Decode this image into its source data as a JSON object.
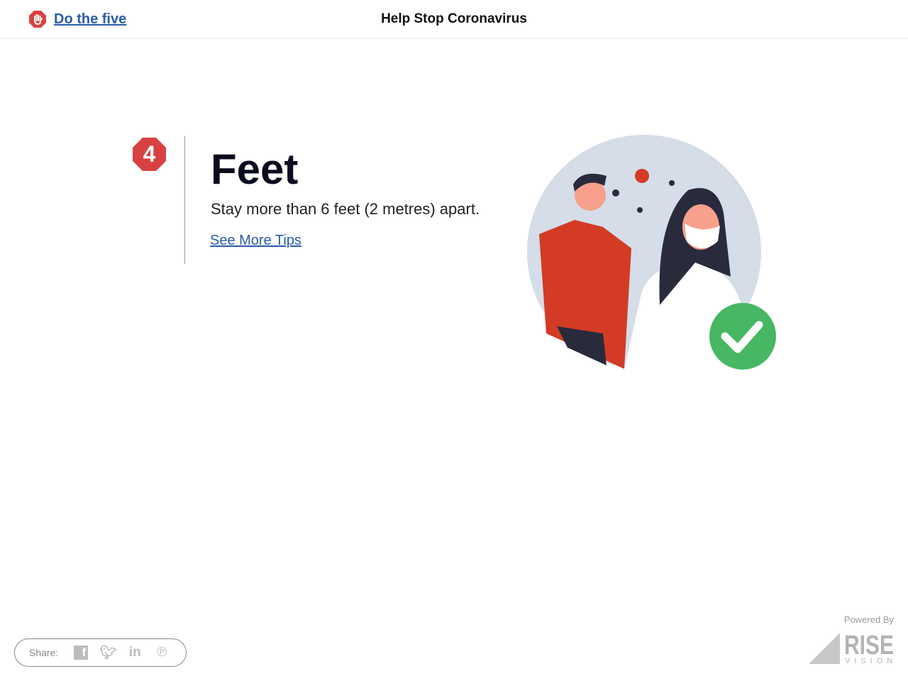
{
  "header": {
    "back_link": "Do the five",
    "title": "Help Stop Coronavirus"
  },
  "step": {
    "number": "4",
    "heading": "Feet",
    "description": "Stay more than 6 feet (2 metres) apart.",
    "link": "See More Tips"
  },
  "colors": {
    "accent": "#d84141",
    "link": "#2a5caa",
    "check": "#47b763"
  },
  "footer": {
    "share_label": "Share:",
    "share_icons": [
      "facebook-icon",
      "twitter-icon",
      "linkedin-icon",
      "pinterest-icon"
    ],
    "powered_by": "Powered By",
    "logo": "RISE VISION"
  }
}
